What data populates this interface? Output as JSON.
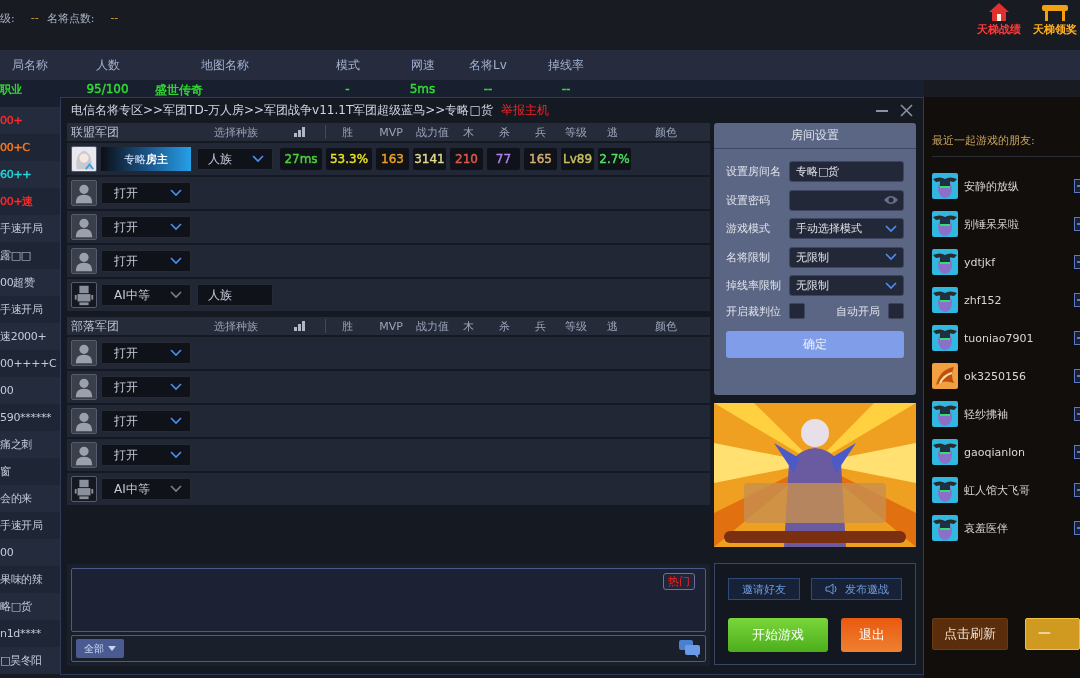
{
  "top": {
    "stats": [
      {
        "label": "级:",
        "value": "--"
      },
      {
        "label": "名将点数:",
        "value": "--"
      }
    ],
    "shortcuts": [
      {
        "label": "天梯战绩"
      },
      {
        "label": "天梯领奖"
      }
    ]
  },
  "lobby": {
    "columns": [
      "局名称",
      "人数",
      "地图名称",
      "模式",
      "网速",
      "名将Lv",
      "掉线率"
    ],
    "rows": [
      {
        "cells": [
          "职业",
          "95/100",
          "盛世传奇",
          "-",
          "5ms",
          "--",
          "--"
        ],
        "color": "#33dd33"
      },
      {
        "cells": [
          "00+"
        ],
        "color": "#ff2a2a"
      },
      {
        "cells": [
          "00+C"
        ],
        "color": "#ff7a1a"
      },
      {
        "cells": [
          "60++"
        ],
        "color": "#22d8e0"
      },
      {
        "cells": [
          "00+速"
        ],
        "color": "#ff2a2a"
      },
      {
        "cells": [
          "手速开局"
        ]
      },
      {
        "cells": [
          "露□□"
        ]
      },
      {
        "cells": [
          "00超赞"
        ]
      },
      {
        "cells": [
          "手速开局"
        ]
      },
      {
        "cells": [
          "速2000+"
        ]
      },
      {
        "cells": [
          "00++++C"
        ]
      },
      {
        "cells": [
          "00"
        ]
      },
      {
        "cells": [
          "590******"
        ]
      },
      {
        "cells": [
          "痛之刺"
        ]
      },
      {
        "cells": [
          "窗"
        ]
      },
      {
        "cells": [
          "会的来"
        ]
      },
      {
        "cells": [
          "手速开局"
        ]
      },
      {
        "cells": [
          "00"
        ]
      },
      {
        "cells": [
          "果味的辣"
        ]
      },
      {
        "cells": [
          "略□货"
        ]
      },
      {
        "cells": [
          "n1d****"
        ]
      },
      {
        "cells": [
          "□昊冬阳"
        ]
      }
    ]
  },
  "friends": {
    "title": "最近一起游戏的朋友:",
    "items": [
      {
        "name": "安静的放纵",
        "kind": "demon"
      },
      {
        "name": "别锤呆呆啦",
        "kind": "demon"
      },
      {
        "name": "ydtjkf",
        "kind": "demon"
      },
      {
        "name": "zhf152",
        "kind": "demon"
      },
      {
        "name": "tuoniao7901",
        "kind": "demon"
      },
      {
        "name": "ok3250156",
        "kind": "dragon"
      },
      {
        "name": "轻纱拂袖",
        "kind": "demon"
      },
      {
        "name": "gaoqianlon",
        "kind": "demon"
      },
      {
        "name": "虹人馆大飞哥",
        "kind": "demon"
      },
      {
        "name": "哀羞医伴",
        "kind": "demon"
      }
    ],
    "buttons": [
      "点击刷新",
      "一"
    ]
  },
  "dialog": {
    "title": "电信名将专区>>军团TD-万人房>>军团战争v11.1T军团超级蓝鸟>>专略□货",
    "report": "举报主机",
    "teams": [
      {
        "name": "联盟军团",
        "columns": [
          "选择种族",
          "胜",
          "MVP",
          "战力值",
          "木",
          "杀",
          "兵",
          "等级",
          "逃",
          "颜色"
        ],
        "slots": [
          {
            "kind": "host",
            "name": "专略",
            "badge": "房主",
            "race": "人族",
            "stats": [
              {
                "value": "27ms",
                "color": "#4cd43a"
              },
              {
                "value": "53.3%",
                "color": "#e8e020"
              },
              {
                "value": "163",
                "color": "#f0a020"
              },
              {
                "value": "3141",
                "color": "#e0d890"
              },
              {
                "value": "210",
                "color": "#e05a4a"
              },
              {
                "value": "77",
                "color": "#b080f0"
              },
              {
                "value": "165",
                "color": "#d8b070"
              },
              {
                "value": "Lv89",
                "color": "#c8c060"
              },
              {
                "value": "2.7%",
                "color": "#50e060"
              }
            ]
          },
          {
            "kind": "open",
            "option": "打开"
          },
          {
            "kind": "open",
            "option": "打开"
          },
          {
            "kind": "open",
            "option": "打开"
          },
          {
            "kind": "ai",
            "option": "AI中等",
            "race": "人族"
          }
        ]
      },
      {
        "name": "部落军团",
        "columns": [
          "选择种族",
          "胜",
          "MVP",
          "战力值",
          "木",
          "杀",
          "兵",
          "等级",
          "逃",
          "颜色"
        ],
        "slots": [
          {
            "kind": "open",
            "option": "打开"
          },
          {
            "kind": "open",
            "option": "打开"
          },
          {
            "kind": "open",
            "option": "打开"
          },
          {
            "kind": "open",
            "option": "打开"
          },
          {
            "kind": "ai",
            "option": "AI中等"
          }
        ]
      }
    ],
    "chat": {
      "tag": "热门",
      "channel": "全部"
    },
    "settings": {
      "title": "房间设置",
      "fields": [
        {
          "label": "设置房间名",
          "kind": "text",
          "value": "专略□货"
        },
        {
          "label": "设置密码",
          "kind": "password"
        },
        {
          "label": "游戏模式",
          "kind": "select",
          "value": "手动选择模式"
        },
        {
          "label": "名将限制",
          "kind": "select",
          "value": "无限制"
        },
        {
          "label": "掉线率限制",
          "kind": "select",
          "value": "无限制"
        }
      ],
      "toggles": [
        {
          "label": "开启裁判位",
          "checked": false
        },
        {
          "label": "自动开局",
          "checked": false
        }
      ],
      "confirm": "确定"
    },
    "actions": {
      "invite": "邀请好友",
      "challenge": "发布邀战",
      "start": "开始游戏",
      "exit": "退出"
    }
  }
}
